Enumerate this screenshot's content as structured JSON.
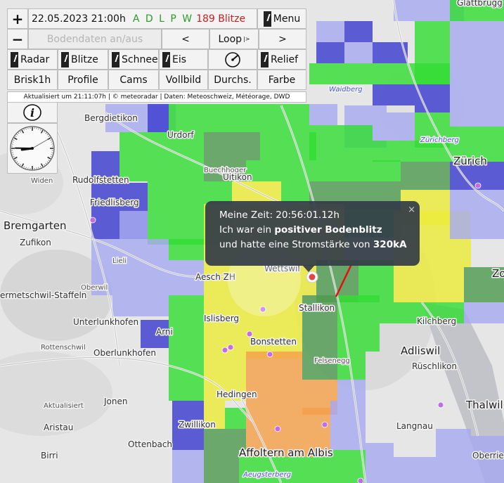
{
  "toolbar": {
    "zoom_in": "+",
    "zoom_out": "−",
    "datetime": "22.05.2023 21:00h",
    "source_letters": "A D L P W",
    "lightning_count": "189 Blitze",
    "menu_label": "Menu",
    "ground_toggle_label": "Bodendaten an/aus",
    "prev_label": "<",
    "loop_label": "Loop",
    "loop_suffix": "|>",
    "next_label": ">",
    "radar_label": "Radar",
    "blitze_label": "Blitze",
    "schnee_label": "Schnee",
    "eis_label": "Eis",
    "relief_label": "Relief",
    "brisk_label": "Brisk1h",
    "profile_label": "Profile",
    "cams_label": "Cams",
    "vollbild_label": "Vollbild",
    "durchs_label": "Durchs.",
    "farbe_label": "Farbe",
    "credit": "Aktualisiert um 21:11:07h | © meteoradar | Daten: Meteoschweiz, Météorage, DWD"
  },
  "clock": {
    "hour": 8,
    "minute": 45,
    "second": 10
  },
  "popup": {
    "line1": "Meine Zeit: 20:56:01.12h",
    "line2_prefix": "Ich war ein",
    "line2_bold": "positiver Bodenblitz",
    "line3_prefix": "und hatte eine Stromstärke von",
    "line3_bold": "320kA",
    "close": "×"
  },
  "map": {
    "colors": {
      "blue": "#3c3ccf",
      "light_blue": "#a7a9f0",
      "green": "#33dd33",
      "dark_green": "#4f9a4f",
      "yellow": "#ecec3a",
      "orange": "#f4a04a"
    },
    "places": [
      "Glattbrugg",
      "Bergdietikon",
      "Urdorf",
      "Waidberg",
      "Zürichberg",
      "Zürich",
      "Buechhoger",
      "Uitikon",
      "Widen",
      "Rudolfstetten",
      "Friedlisberg",
      "Bremgarten",
      "Zufikon",
      "Lieli",
      "Aesch ZH",
      "Wettswil",
      "Oberwil",
      "ermetschwil-Staffeln",
      "Unterlunkhofen",
      "Stallikon",
      "Kilchberg",
      "Islisberg",
      "Arni",
      "Rottenschwil",
      "Oberlunkhofen",
      "Bonstetten",
      "Adliswil",
      "Felsenegg",
      "Rüschlikon",
      "Hedingen",
      "Jonen",
      "Aktualisiert",
      "Thalwil",
      "Aristau",
      "Zwillikon",
      "Langnau",
      "Ottenbach",
      "Affoltern am Albis",
      "Birri",
      "Oberrieden",
      "Aeugsterberg",
      "Zo"
    ]
  }
}
